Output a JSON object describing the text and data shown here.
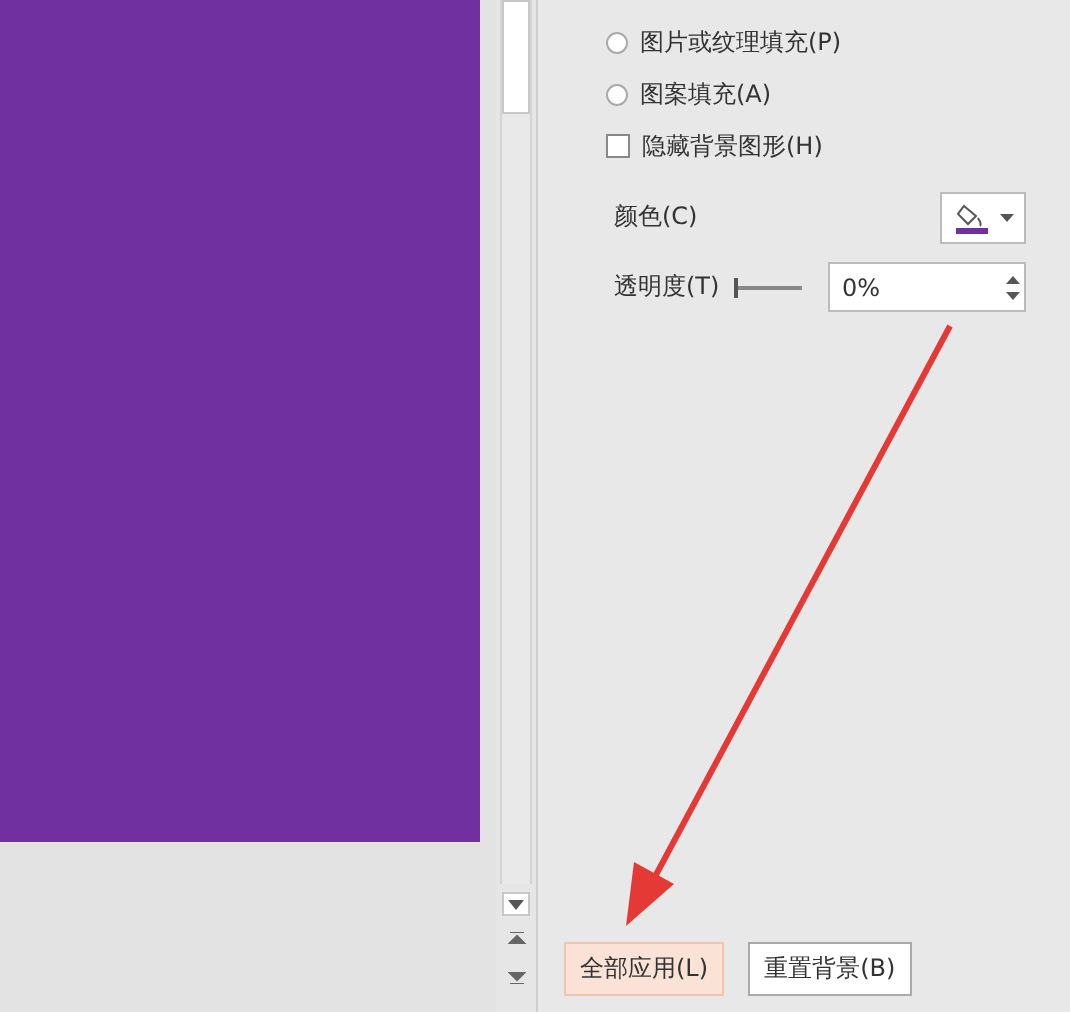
{
  "fill_options": [
    {
      "kind": "radio",
      "label": "图片或纹理填充(P)",
      "selected": false
    },
    {
      "kind": "radio",
      "label": "图案填充(A)",
      "selected": false
    },
    {
      "kind": "checkbox",
      "label": "隐藏背景图形(H)",
      "checked": false
    }
  ],
  "color": {
    "label": "颜色(C)"
  },
  "transparency": {
    "label": "透明度(T)",
    "level": 0,
    "value": "0%"
  },
  "buttons": [
    {
      "label": "全部应用(L)",
      "highlighted": true
    },
    {
      "label": "重置背景(B)",
      "highlighted": false
    }
  ]
}
